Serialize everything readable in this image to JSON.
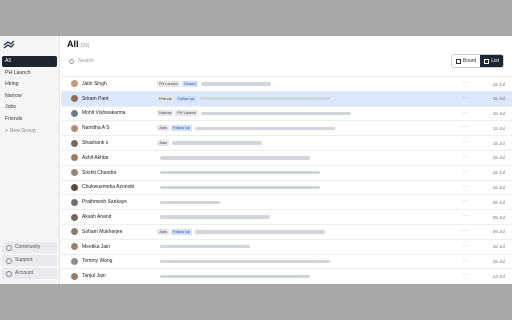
{
  "sidebar": {
    "items": [
      {
        "label": "All",
        "active": true
      },
      {
        "label": "PH Launch"
      },
      {
        "label": "Hiring"
      },
      {
        "label": "Narrow"
      },
      {
        "label": "Jobs"
      },
      {
        "label": "Friends"
      },
      {
        "label": "+ New Group"
      }
    ],
    "bottom": [
      {
        "label": "Community",
        "icon": "people-icon"
      },
      {
        "label": "Support",
        "icon": "help-icon"
      },
      {
        "label": "Account",
        "icon": "user-icon"
      }
    ]
  },
  "main": {
    "title": "All",
    "count": "(99)",
    "search_placeholder": "Search",
    "view": {
      "board": "Board",
      "list": "List",
      "active": "List"
    }
  },
  "rows": [
    {
      "name": "Jatin Singh",
      "tags": [
        "PH Launch",
        "Closed"
      ],
      "date": "15 Jul",
      "avatar": "#c49a7a"
    },
    {
      "name": "Sriram Pant",
      "tags": [
        "Friends",
        "Follow Up"
      ],
      "date": "15 Jul",
      "avatar": "#8a6d5a",
      "selected": true
    },
    {
      "name": "Mohit Vishwakarma",
      "tags": [
        "Narrow",
        "PH Launch"
      ],
      "date": "15 Jul",
      "avatar": "#6b7b8c"
    },
    {
      "name": "Namitha A S",
      "tags": [
        "Jobs",
        "Follow Up"
      ],
      "date": "15 Jul",
      "avatar": "#b58c6f"
    },
    {
      "name": "Shashank s",
      "tags": [
        "Jobs"
      ],
      "date": "15 Jul",
      "avatar": "#7d6a62"
    },
    {
      "name": "Ashif Akhtar",
      "tags": [],
      "date": "15 Jul",
      "avatar": "#a0785a"
    },
    {
      "name": "Srishti Chandra",
      "tags": [],
      "date": "15 Jul",
      "avatar": "#9a8475"
    },
    {
      "name": "Chukwuemeka Azonobi",
      "tags": [],
      "date": "15 Jul",
      "avatar": "#5d4a3e"
    },
    {
      "name": "Prathmesh Sankaye",
      "tags": [],
      "date": "09 Jul",
      "avatar": "#6f6f6f"
    },
    {
      "name": "Akash Anand",
      "tags": [],
      "date": "09 Jul",
      "avatar": "#7a6658"
    },
    {
      "name": "Soham Mukherjee",
      "tags": [
        "Jobs",
        "Follow Up"
      ],
      "date": "09 Jul",
      "avatar": "#8b7a6a"
    },
    {
      "name": "Meetika Jain",
      "tags": [],
      "date": "15 Jul",
      "avatar": "#a67f6b"
    },
    {
      "name": "Tommy Wang",
      "tags": [],
      "date": "15 Jul",
      "avatar": "#8e8e8e"
    },
    {
      "name": "Tanjul Jain",
      "tags": [],
      "date": "13 Jul",
      "avatar": "#9c7c62"
    }
  ]
}
